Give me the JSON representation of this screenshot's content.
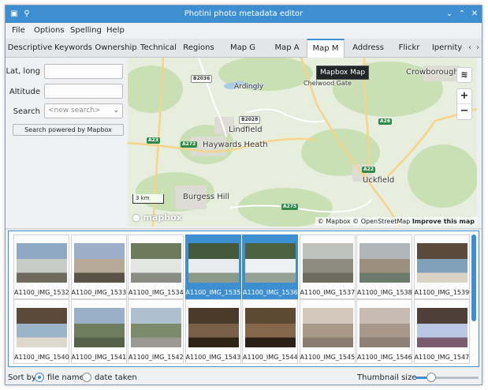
{
  "window": {
    "title": "Photini photo metadata editor"
  },
  "menubar": [
    "File",
    "Options",
    "Spelling",
    "Help"
  ],
  "tabs": [
    "Descriptive",
    "Keywords",
    "Ownership",
    "Technical",
    "Regions",
    "Map G",
    "Map A",
    "Map M",
    "Address",
    "Flickr",
    "Ipernity"
  ],
  "active_tab": "Map M",
  "tooltip": "Mapbox Map",
  "left_panel": {
    "lat_long_label": "Lat, long",
    "lat_long_value": "",
    "altitude_label": "Altitude",
    "altitude_value": "",
    "search_label": "Search",
    "search_placeholder": "<new search>",
    "search_button": "Search powered by Mapbox"
  },
  "map": {
    "places": [
      "Ardingly",
      "Chelwood Gate",
      "Crowborough",
      "Lindfield",
      "Haywards Heath",
      "Uckfield",
      "Burgess Hill"
    ],
    "roads": [
      "B2036",
      "B2028",
      "A272",
      "A23",
      "A275",
      "A22",
      "A26"
    ],
    "scale": "3 km",
    "logo": "mapbox",
    "attribution_mapbox": "© Mapbox",
    "attribution_osm": "© OpenStreetMap",
    "attribution_improve": "Improve this map",
    "zoom_in": "+",
    "zoom_out": "−"
  },
  "thumbnails": [
    {
      "name": "A1100_IMG_1532",
      "selected": false
    },
    {
      "name": "A1100_IMG_1533",
      "selected": false
    },
    {
      "name": "A1100_IMG_1534",
      "selected": false
    },
    {
      "name": "A1100_IMG_1535",
      "selected": true
    },
    {
      "name": "A1100_IMG_1536",
      "selected": true
    },
    {
      "name": "A1100_IMG_1537",
      "selected": false
    },
    {
      "name": "A1100_IMG_1538",
      "selected": false
    },
    {
      "name": "A1100_IMG_1539",
      "selected": false
    },
    {
      "name": "A1100_IMG_1540",
      "selected": false
    },
    {
      "name": "A1100_IMG_1541",
      "selected": false
    },
    {
      "name": "A1100_IMG_1542",
      "selected": false
    },
    {
      "name": "A1100_IMG_1543",
      "selected": false
    },
    {
      "name": "A1100_IMG_1544",
      "selected": false
    },
    {
      "name": "A1100_IMG_1545",
      "selected": false
    },
    {
      "name": "A1100_IMG_1546",
      "selected": false
    },
    {
      "name": "A1100_IMG_1547",
      "selected": false
    }
  ],
  "statusbar": {
    "sort_by": "Sort by",
    "file_name": "file name",
    "date_taken": "date taken",
    "sort_selected": "file name",
    "thumbnail_size": "Thumbnail size",
    "thumbnail_size_level": 0.25
  },
  "colors": {
    "accent": "#3d8fd1",
    "background": "#eff0f1",
    "map_land": "#e8eedd",
    "map_water": "#a8cde6",
    "map_wood": "#c9dfb4"
  }
}
